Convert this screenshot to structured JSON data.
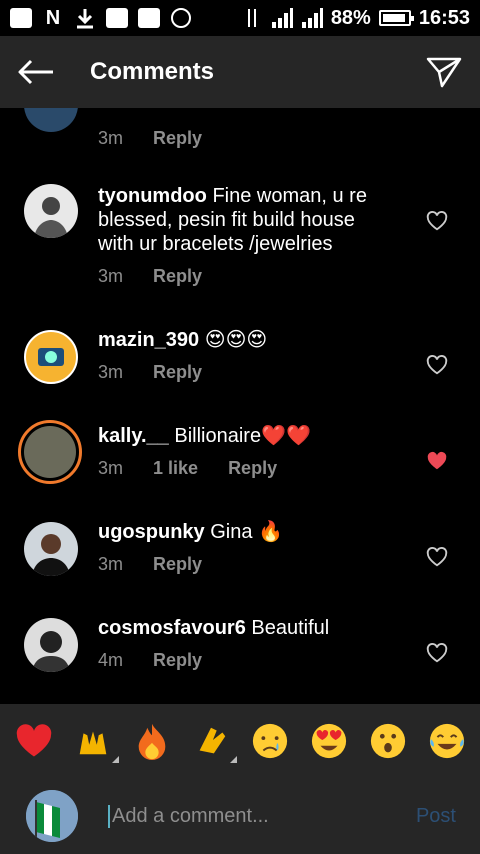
{
  "status_bar": {
    "battery": "88%",
    "time": "16:53",
    "network": "H"
  },
  "header": {
    "title": "Comments"
  },
  "comments": [
    {
      "username": "",
      "text": "",
      "time": "3m",
      "likes": "",
      "reply": "Reply",
      "liked": false
    },
    {
      "username": "tyonumdoo",
      "text": "Fine woman, u re blessed, pesin fit build house with ur bracelets /jewelries",
      "time": "3m",
      "likes": "",
      "reply": "Reply",
      "liked": false
    },
    {
      "username": "mazin_390",
      "text": "😍😍😍",
      "time": "3m",
      "likes": "",
      "reply": "Reply",
      "liked": false
    },
    {
      "username": "kally.__",
      "text": "Billionaire❤️❤️",
      "time": "3m",
      "likes": "1 like",
      "reply": "Reply",
      "liked": true
    },
    {
      "username": "ugospunky",
      "text": "Gina 🔥",
      "time": "3m",
      "likes": "",
      "reply": "Reply",
      "liked": false
    },
    {
      "username": "cosmosfavour6",
      "text": "Beautiful",
      "time": "4m",
      "likes": "",
      "reply": "Reply",
      "liked": false
    }
  ],
  "reactions": [
    "❤️",
    "🙌",
    "🔥",
    "👏",
    "😢",
    "😍",
    "😮",
    "😂"
  ],
  "input": {
    "placeholder": "Add a comment...",
    "post_label": "Post"
  },
  "colors": {
    "background": "#000000",
    "bar": "#262626",
    "muted": "#8e8e8e",
    "like_red": "#ed4956",
    "post_disabled": "#2c4f74"
  },
  "icons": {
    "back": "arrow-left-icon",
    "send": "paper-plane-icon",
    "heart": "heart-icon"
  }
}
